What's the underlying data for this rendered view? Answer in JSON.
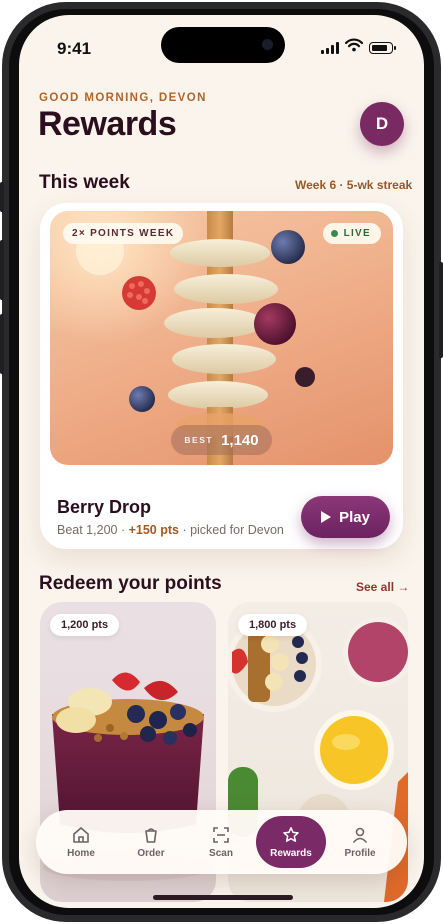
{
  "status_bar": {
    "time": "9:41"
  },
  "header": {
    "greeting": "GOOD MORNING, DEVON",
    "title": "Rewards",
    "avatar_initial": "D"
  },
  "this_week": {
    "title": "This week",
    "meta": "Week 6 · 5-wk streak",
    "card": {
      "badge": "2× POINTS WEEK",
      "live_label": "LIVE",
      "best_label": "BEST",
      "best_value": "1,140",
      "game_name": "Berry Drop",
      "sub_prefix": "Beat 1,200 · ",
      "sub_bonus": "+150 pts",
      "sub_suffix": " · picked for Devon",
      "play_label": "Play"
    }
  },
  "redeem": {
    "title": "Redeem your points",
    "see_all": "See all →",
    "items": [
      {
        "points": "1,200 pts"
      },
      {
        "points": "1,800 pts"
      }
    ]
  },
  "tabbar": {
    "tabs": [
      {
        "label": "Home",
        "icon": "home-icon"
      },
      {
        "label": "Order",
        "icon": "cup-icon"
      },
      {
        "label": "Scan",
        "icon": "scan-icon"
      },
      {
        "label": "Rewards",
        "icon": "star-icon",
        "active": true
      },
      {
        "label": "Profile",
        "icon": "person-icon"
      }
    ]
  },
  "colors": {
    "brand": "#7a2a66",
    "accent": "#b0662a",
    "live": "#3b8a4b",
    "background": "#faf4ec"
  }
}
